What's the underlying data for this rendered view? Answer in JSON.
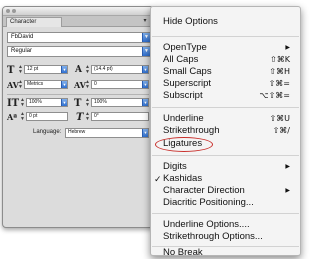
{
  "panel": {
    "tab_label": "Character",
    "menu_button": "▾",
    "font_family": "FbDavid",
    "font_style": "Regular",
    "font_size": "12 pt",
    "leading": "(14.4 pt)",
    "kerning": "Metrics",
    "tracking": "0",
    "vertical_scale": "100%",
    "horizontal_scale": "100%",
    "baseline_shift": "0 pt",
    "skew": "0°",
    "language_label": "Language:",
    "language_value": "Hebrew",
    "dropdown_glyph": "▼"
  },
  "menu": {
    "hide_options": "Hide Options",
    "opentype": "OpenType",
    "all_caps": "All Caps",
    "all_caps_sc": "⇧⌘K",
    "small_caps": "Small Caps",
    "small_caps_sc": "⇧⌘H",
    "superscript": "Superscript",
    "superscript_sc": "⇧⌘=",
    "subscript": "Subscript",
    "subscript_sc": "⌥⇧⌘=",
    "underline": "Underline",
    "underline_sc": "⇧⌘U",
    "strikethrough": "Strikethrough",
    "strikethrough_sc": "⇧⌘/",
    "ligatures": "Ligatures",
    "digits": "Digits",
    "kashidas": "Kashidas",
    "character_direction": "Character Direction",
    "diacritic_positioning": "Diacritic Positioning...",
    "underline_options": "Underline Options....",
    "strikethrough_options": "Strikethrough Options...",
    "no_break": "No Break",
    "submenu_arrow": "▶",
    "check": "✓"
  }
}
